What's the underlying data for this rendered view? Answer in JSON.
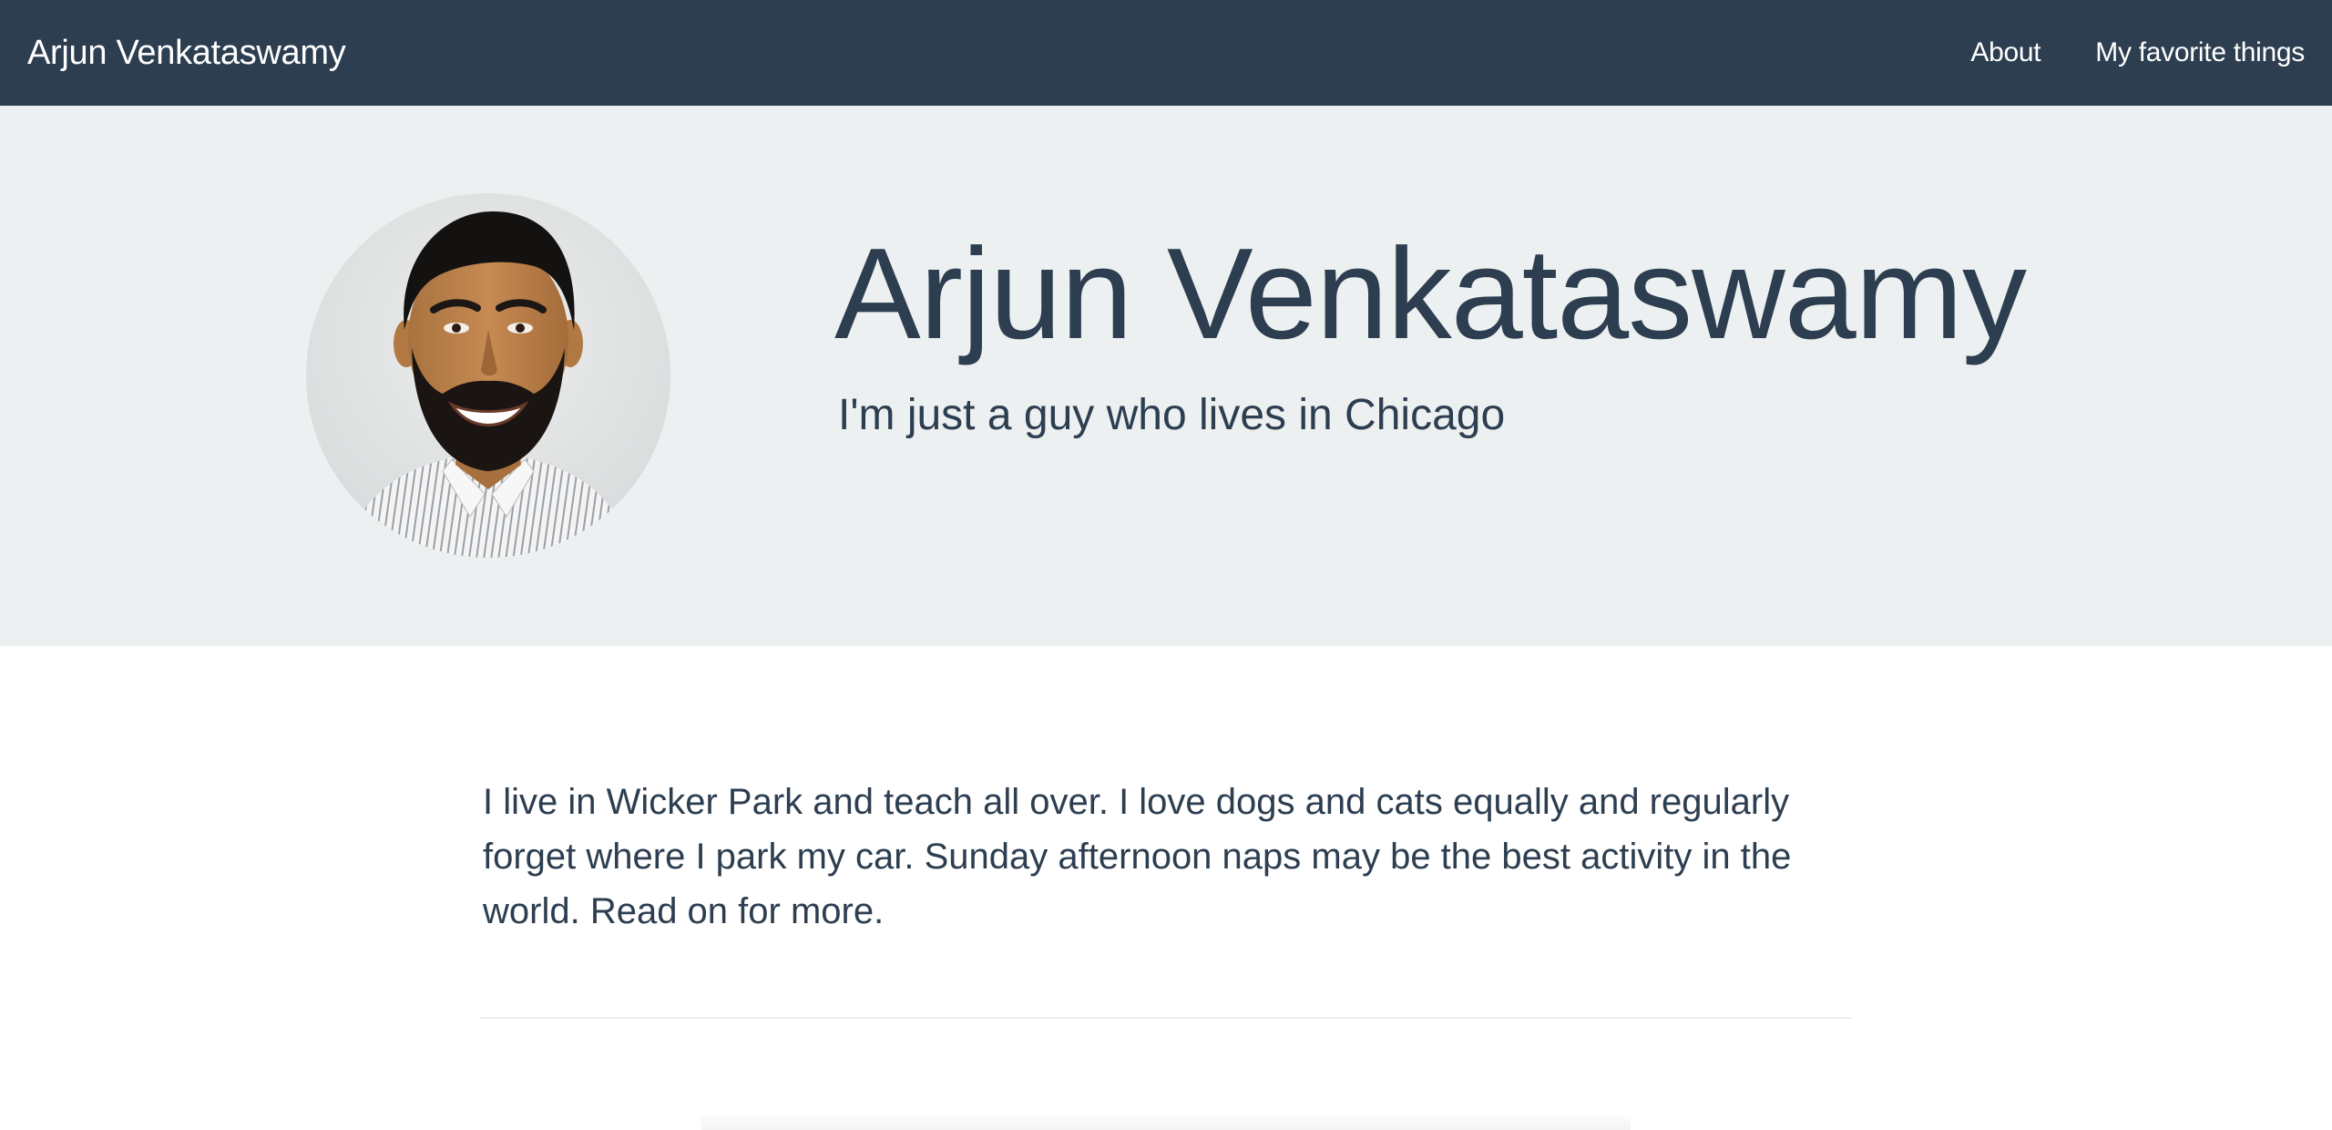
{
  "navbar": {
    "brand": "Arjun Venkataswamy",
    "links": [
      {
        "label": "About"
      },
      {
        "label": "My favorite things"
      }
    ]
  },
  "hero": {
    "title": "Arjun Venkataswamy",
    "subtitle": "I'm just a guy who lives in Chicago"
  },
  "intro": {
    "text": "I live in Wicker Park and teach all over. I love dogs and cats equally and regularly forget where I park my car. Sunday afternoon naps may be the best activity in the world. Read on for more."
  },
  "colors": {
    "primary": "#2c3e50",
    "hero_background": "#ecf0f1",
    "page_background": "#ffffff"
  }
}
